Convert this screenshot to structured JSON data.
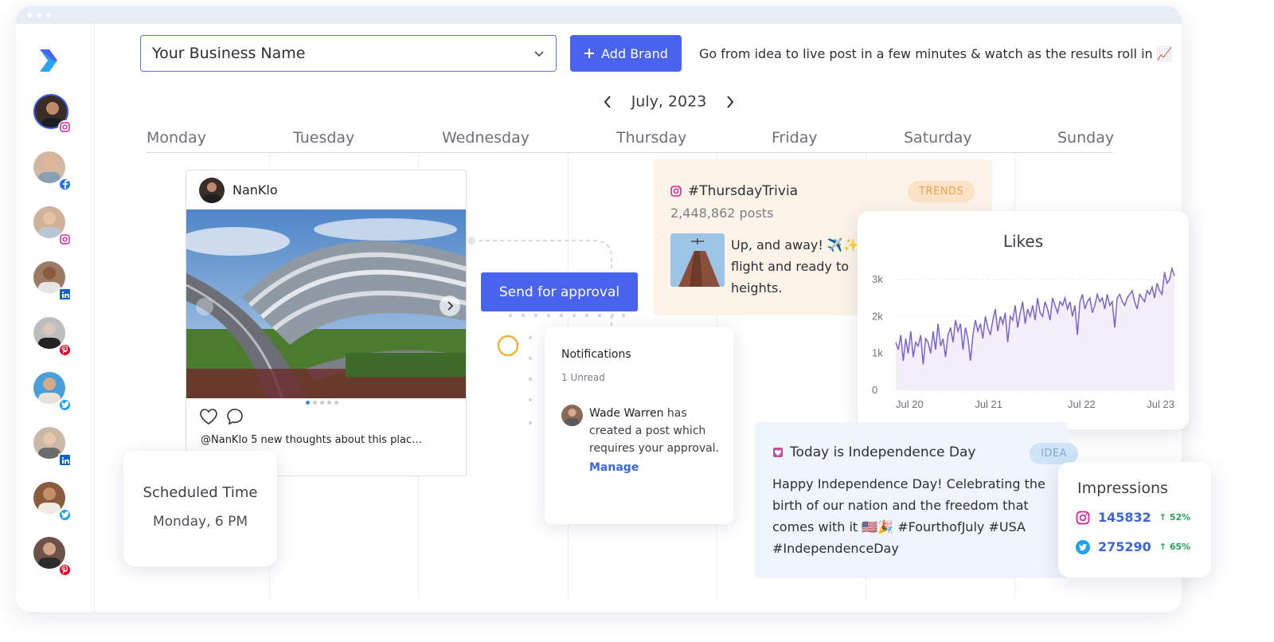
{
  "header": {
    "brand_select_value": "Your Business Name",
    "add_brand_label": "Add Brand",
    "tagline": "Go from idea to live post in a few minutes & watch as the results roll in 📈"
  },
  "sidebar": {
    "accounts": [
      {
        "network": "instagram"
      },
      {
        "network": "facebook"
      },
      {
        "network": "instagram"
      },
      {
        "network": "linkedin"
      },
      {
        "network": "pinterest"
      },
      {
        "network": "twitter"
      },
      {
        "network": "linkedin"
      },
      {
        "network": "twitter"
      },
      {
        "network": "pinterest"
      }
    ]
  },
  "calendar": {
    "month_label": "July, 2023",
    "days": [
      "Monday",
      "Tuesday",
      "Wednesday",
      "Thursday",
      "Friday",
      "Saturday",
      "Sunday"
    ]
  },
  "post": {
    "username": "NanKlo",
    "caption": "@NanKlo  5 new thoughts about this plac…"
  },
  "scheduled": {
    "title": "Scheduled Time",
    "value": "Monday, 6 PM"
  },
  "approval": {
    "button_label": "Send for approval"
  },
  "notifications": {
    "title": "Notifications",
    "unread": "1 Unread",
    "user": "Wade Warren",
    "message": " has created a post which requires your approval.",
    "action": "Manage"
  },
  "trend": {
    "hashtag": "#ThursdayTrivia",
    "count": "2,448,862 posts",
    "badge": "TRENDS",
    "text": "Up, and away! ✈️✨ flight and ready to heights."
  },
  "likes_chart": {
    "title": "Likes",
    "y_ticks": [
      "3k",
      "2k",
      "1k",
      "0"
    ],
    "x_ticks": [
      "Jul 20",
      "Jul 21",
      "Jul 22",
      "Jul 23"
    ]
  },
  "chart_data": {
    "type": "line",
    "title": "Likes",
    "xlabel": "",
    "ylabel": "",
    "ylim": [
      0,
      3300
    ],
    "x_tick_labels": [
      "Jul 20",
      "Jul 21",
      "Jul 22",
      "Jul 23"
    ],
    "series": [
      {
        "values": [
          1300,
          1100,
          1500,
          800,
          1400,
          1000,
          1600,
          900,
          1300,
          1200,
          1500,
          700,
          1400,
          1300,
          1000,
          1600,
          1100,
          1800,
          1200,
          1400,
          900,
          1500,
          1700,
          1300,
          1900,
          1600,
          1800,
          1100,
          1700,
          1400,
          800,
          1500,
          1900,
          1600,
          1800,
          1400,
          2000,
          1700,
          1500,
          1900,
          2200,
          1600,
          2000,
          1800,
          2100,
          1300,
          2000,
          1900,
          2300,
          1700,
          2100,
          2400,
          1800,
          2200,
          2000,
          2300,
          1900,
          2500,
          2100,
          2000,
          2400,
          2200,
          1900,
          2500,
          2300,
          2100,
          2400,
          2300,
          2500,
          2200,
          2400,
          2000,
          2300,
          1500,
          2400,
          2600,
          2200,
          2400,
          2500,
          2100,
          2300,
          2600,
          2400,
          2500,
          2200,
          2600,
          2300,
          2400,
          1700,
          2500,
          2600,
          2400,
          2300,
          2500,
          2600,
          2700,
          2400,
          2200,
          2600,
          2500,
          2400,
          2700,
          2600,
          2800,
          2500,
          2900,
          2700,
          2600,
          3200,
          2900,
          3000,
          3300,
          3100
        ]
      }
    ]
  },
  "independence": {
    "title": "Today is Independence Day",
    "badge": "IDEA",
    "body": "Happy Independence Day! Celebrating the birth of our nation and the freedom that comes with it 🇺🇸🎉 #FourthofJuly #USA #IndependenceDay"
  },
  "impressions": {
    "title": "Impressions",
    "rows": [
      {
        "network": "instagram",
        "value": "145832",
        "change": "52%"
      },
      {
        "network": "twitter",
        "value": "275290",
        "change": "65%"
      }
    ]
  },
  "colors": {
    "accent": "#4a63ec",
    "instagram": "#d6249f",
    "facebook": "#1877f2",
    "linkedin": "#0a66c2",
    "pinterest": "#e60023",
    "twitter": "#1da1f2"
  }
}
